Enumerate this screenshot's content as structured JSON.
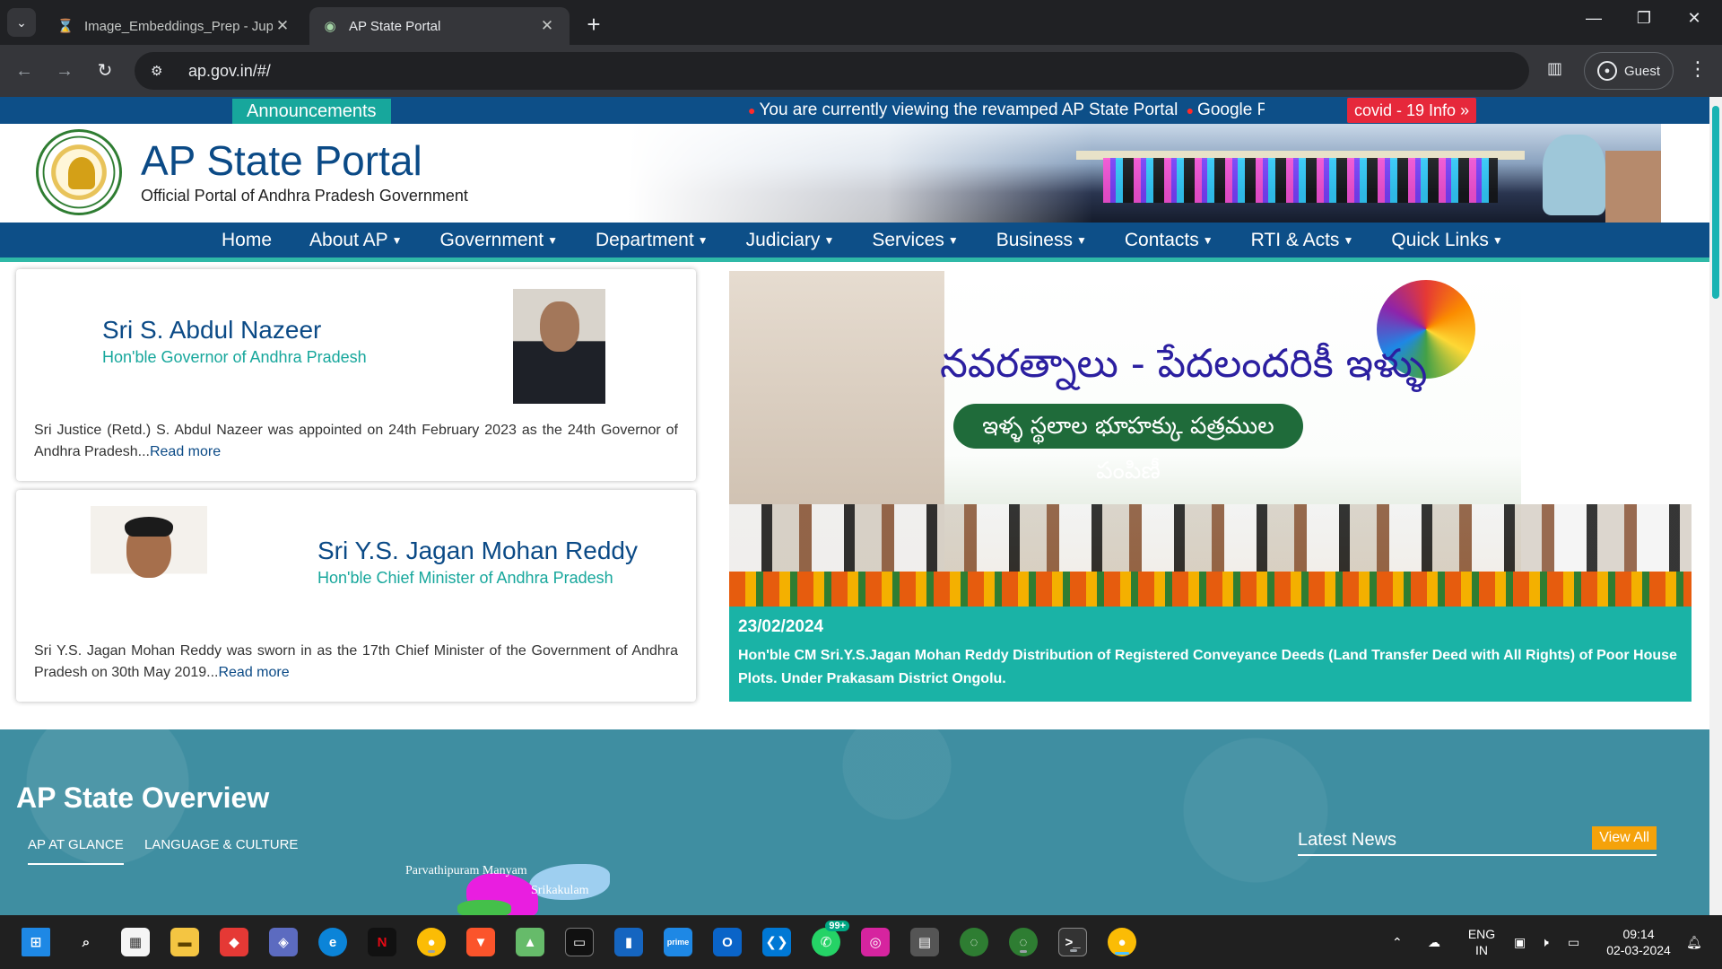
{
  "browser": {
    "tabs": [
      {
        "title": "Image_Embeddings_Prep - Jupy",
        "active": false,
        "icon": "hourglass-icon"
      },
      {
        "title": "AP State Portal",
        "active": true,
        "icon": "globe-icon"
      }
    ],
    "url": "ap.gov.in/#/",
    "profile_label": "Guest"
  },
  "announcements": {
    "label": "Announcements",
    "items": [
      "You are currently viewing the revamped AP State Portal",
      "Google Play S"
    ],
    "covid_label": "covid - 19 Info"
  },
  "header": {
    "title": "AP State Portal",
    "subtitle": "Official Portal of Andhra Pradesh Government"
  },
  "nav": {
    "items": [
      {
        "label": "Home",
        "dropdown": false
      },
      {
        "label": "About AP",
        "dropdown": true
      },
      {
        "label": "Government",
        "dropdown": true
      },
      {
        "label": "Department",
        "dropdown": true
      },
      {
        "label": "Judiciary",
        "dropdown": true
      },
      {
        "label": "Services",
        "dropdown": true
      },
      {
        "label": "Business",
        "dropdown": true
      },
      {
        "label": "Contacts",
        "dropdown": true
      },
      {
        "label": "RTI & Acts",
        "dropdown": true
      },
      {
        "label": "Quick Links",
        "dropdown": true
      }
    ]
  },
  "governor": {
    "name": "Sri S. Abdul Nazeer",
    "role": "Hon'ble Governor of Andhra Pradesh",
    "desc": "Sri Justice (Retd.) S. Abdul Nazeer was appointed on 24th February 2023 as the 24th Governor of Andhra Pradesh...",
    "read_more": "Read more"
  },
  "chief_minister": {
    "name": "Sri Y.S. Jagan Mohan Reddy",
    "role": "Hon'ble Chief Minister of Andhra Pradesh",
    "desc": "Sri Y.S. Jagan Mohan Reddy was sworn in as the 17th Chief Minister of the Government of Andhra Pradesh on 30th May 2019...",
    "read_more": "Read more"
  },
  "slider": {
    "banner_title": "నవరత్నాలు - పేదలందరికీ ఇళ్ళు",
    "banner_pill": "ఇళ్ళ స్థలాల భూహక్కు పత్రముల పంపిణీ",
    "date": "23/02/2024",
    "caption": "Hon'ble CM Sri.Y.S.Jagan Mohan Reddy Distribution of Registered Conveyance Deeds (Land Transfer Deed with All Rights) of Poor House Plots. Under Prakasam District Ongolu."
  },
  "overview": {
    "title": "AP State Overview",
    "tabs": [
      "AP AT GLANCE",
      "LANGUAGE & CULTURE"
    ],
    "map_labels": [
      "Parvathipuram Manyam",
      "Srikakulam"
    ],
    "latest_news_title": "Latest News",
    "view_all": "View All"
  },
  "taskbar": {
    "lang_top": "ENG",
    "lang_bottom": "IN",
    "time": "09:14",
    "date": "02-03-2024",
    "whatsapp_badge": "99+"
  },
  "colors": {
    "nav_blue": "#0d4f88",
    "teal": "#17a79c",
    "covid_red": "#e6283b",
    "overview_bg": "#3f8ea1",
    "view_all_orange": "#f5a20a"
  }
}
